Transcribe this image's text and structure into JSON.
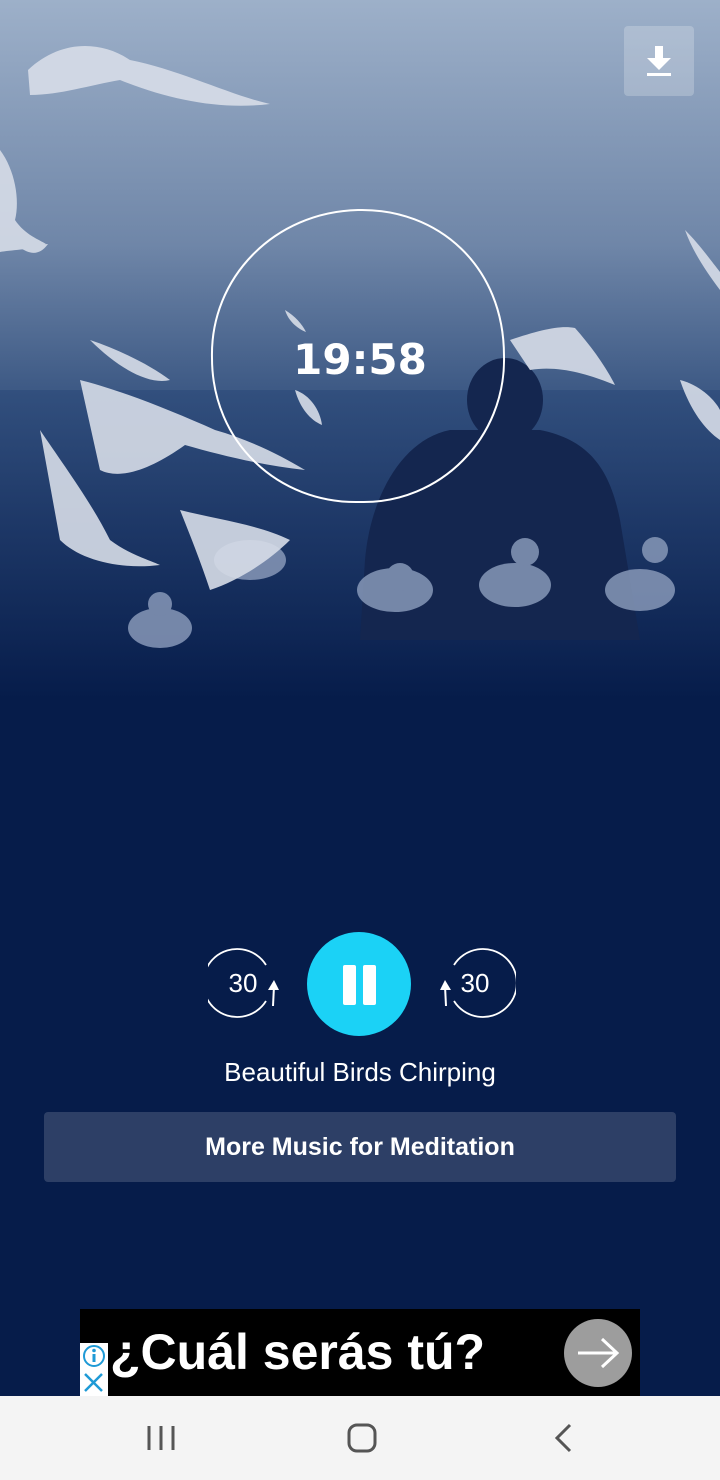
{
  "player": {
    "timer": "19:58",
    "skip_back_seconds": "30",
    "skip_forward_seconds": "30",
    "state": "playing",
    "track_title": "Beautiful Birds Chirping",
    "more_music_label": "More Music for Meditation"
  },
  "toolbar": {
    "download_icon": "download-icon"
  },
  "ad": {
    "headline": "¿Cuál serás tú?"
  },
  "navbar": {
    "recents_icon": "recents-icon",
    "home_icon": "home-icon",
    "back_icon": "back-icon"
  },
  "colors": {
    "background": "#061c4a",
    "accent": "#1bd2f6",
    "button": "#2d3f66",
    "ad_choices": "#1e9ad6"
  }
}
